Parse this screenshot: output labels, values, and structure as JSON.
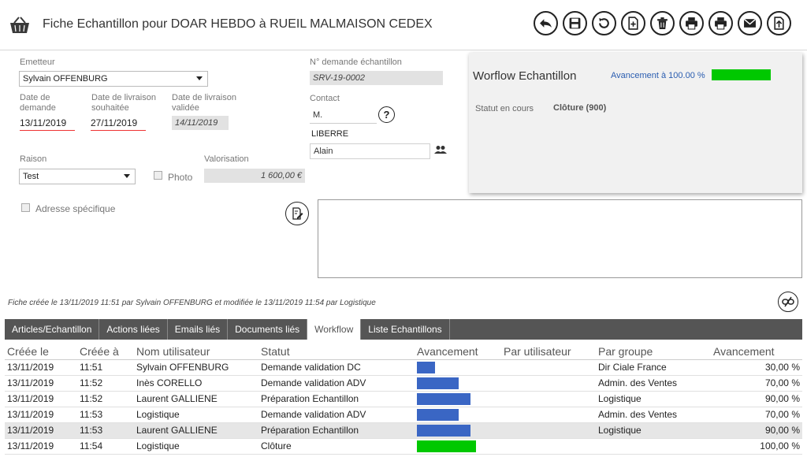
{
  "header": {
    "title": "Fiche Echantillon pour DOAR HEBDO à RUEIL MALMAISON CEDEX",
    "toolbar": [
      "back-icon",
      "save-icon",
      "undo-icon",
      "add-document-icon",
      "delete-icon",
      "print-icon",
      "print-alt-icon",
      "email-icon",
      "export-icon"
    ]
  },
  "form": {
    "emetteur_label": "Emetteur",
    "emetteur_value": "Sylvain OFFENBURG",
    "date_demande_label": "Date de demande",
    "date_demande": "13/11/2019",
    "date_souhaitee_label": "Date de livraison souhaitée",
    "date_souhaitee": "27/11/2019",
    "date_validee_label": "Date de livraison validée",
    "date_validee": "14/11/2019",
    "raison_label": "Raison",
    "raison_value": "Test",
    "photo_label": "Photo",
    "valorisation_label": "Valorisation",
    "valorisation_value": "1 600,00 €",
    "adresse_label": "Adresse spécifique",
    "num_label": "N° demande échantillon",
    "num_value": "SRV-19-0002",
    "contact_label": "Contact",
    "contact_civ": "M.",
    "contact_nom": "LIBERRE",
    "contact_prenom": "Alain"
  },
  "workflow_panel": {
    "title": "Worflow Echantillon",
    "progress_label": "Avancement à 100.00 %",
    "progress": 1.0,
    "status_label": "Statut en cours",
    "status_value": "Clôture (900)"
  },
  "footer_note": "Fiche créée le 13/11/2019 11:51 par Sylvain OFFENBURG et modifiée le 13/11/2019 11:54 par Logistique",
  "tabs": [
    {
      "label": "Articles/Echantillon",
      "active": false
    },
    {
      "label": "Actions liées",
      "active": false
    },
    {
      "label": "Emails liés",
      "active": false
    },
    {
      "label": "Documents liés",
      "active": false
    },
    {
      "label": "Workflow",
      "active": true
    },
    {
      "label": "Liste Echantillons",
      "active": false
    }
  ],
  "table": {
    "headers": [
      "Créée le",
      "Créée à",
      "Nom utilisateur",
      "Statut",
      "Avancement",
      "Par utilisateur",
      "Par groupe",
      "Avancement"
    ],
    "rows": [
      {
        "date": "13/11/2019",
        "time": "11:51",
        "user": "Sylvain OFFENBURG",
        "status": "Demande validation DC",
        "bar": 0.3,
        "par_user": "",
        "group": "Dir Ciale France",
        "pct": "30,00 %",
        "color": "#3a66c4"
      },
      {
        "date": "13/11/2019",
        "time": "11:52",
        "user": "Inès CORELLO",
        "status": "Demande validation ADV",
        "bar": 0.7,
        "par_user": "",
        "group": "Admin. des Ventes",
        "pct": "70,00 %",
        "color": "#3a66c4"
      },
      {
        "date": "13/11/2019",
        "time": "11:52",
        "user": "Laurent GALLIENE",
        "status": "Préparation Echantillon",
        "bar": 0.9,
        "par_user": "",
        "group": "Logistique",
        "pct": "90,00 %",
        "color": "#3a66c4"
      },
      {
        "date": "13/11/2019",
        "time": "11:53",
        "user": "Logistique",
        "status": "Demande validation ADV",
        "bar": 0.7,
        "par_user": "",
        "group": "Admin. des Ventes",
        "pct": "70,00 %",
        "color": "#3a66c4"
      },
      {
        "date": "13/11/2019",
        "time": "11:53",
        "user": "Laurent GALLIENE",
        "status": "Préparation Echantillon",
        "bar": 0.9,
        "par_user": "",
        "group": "Logistique",
        "pct": "90,00 %",
        "color": "#3a66c4",
        "selected": true
      },
      {
        "date": "13/11/2019",
        "time": "11:54",
        "user": "Logistique",
        "status": "Clôture",
        "bar": 1.0,
        "par_user": "",
        "group": "",
        "pct": "100,00 %",
        "color": "#00c800"
      }
    ]
  }
}
